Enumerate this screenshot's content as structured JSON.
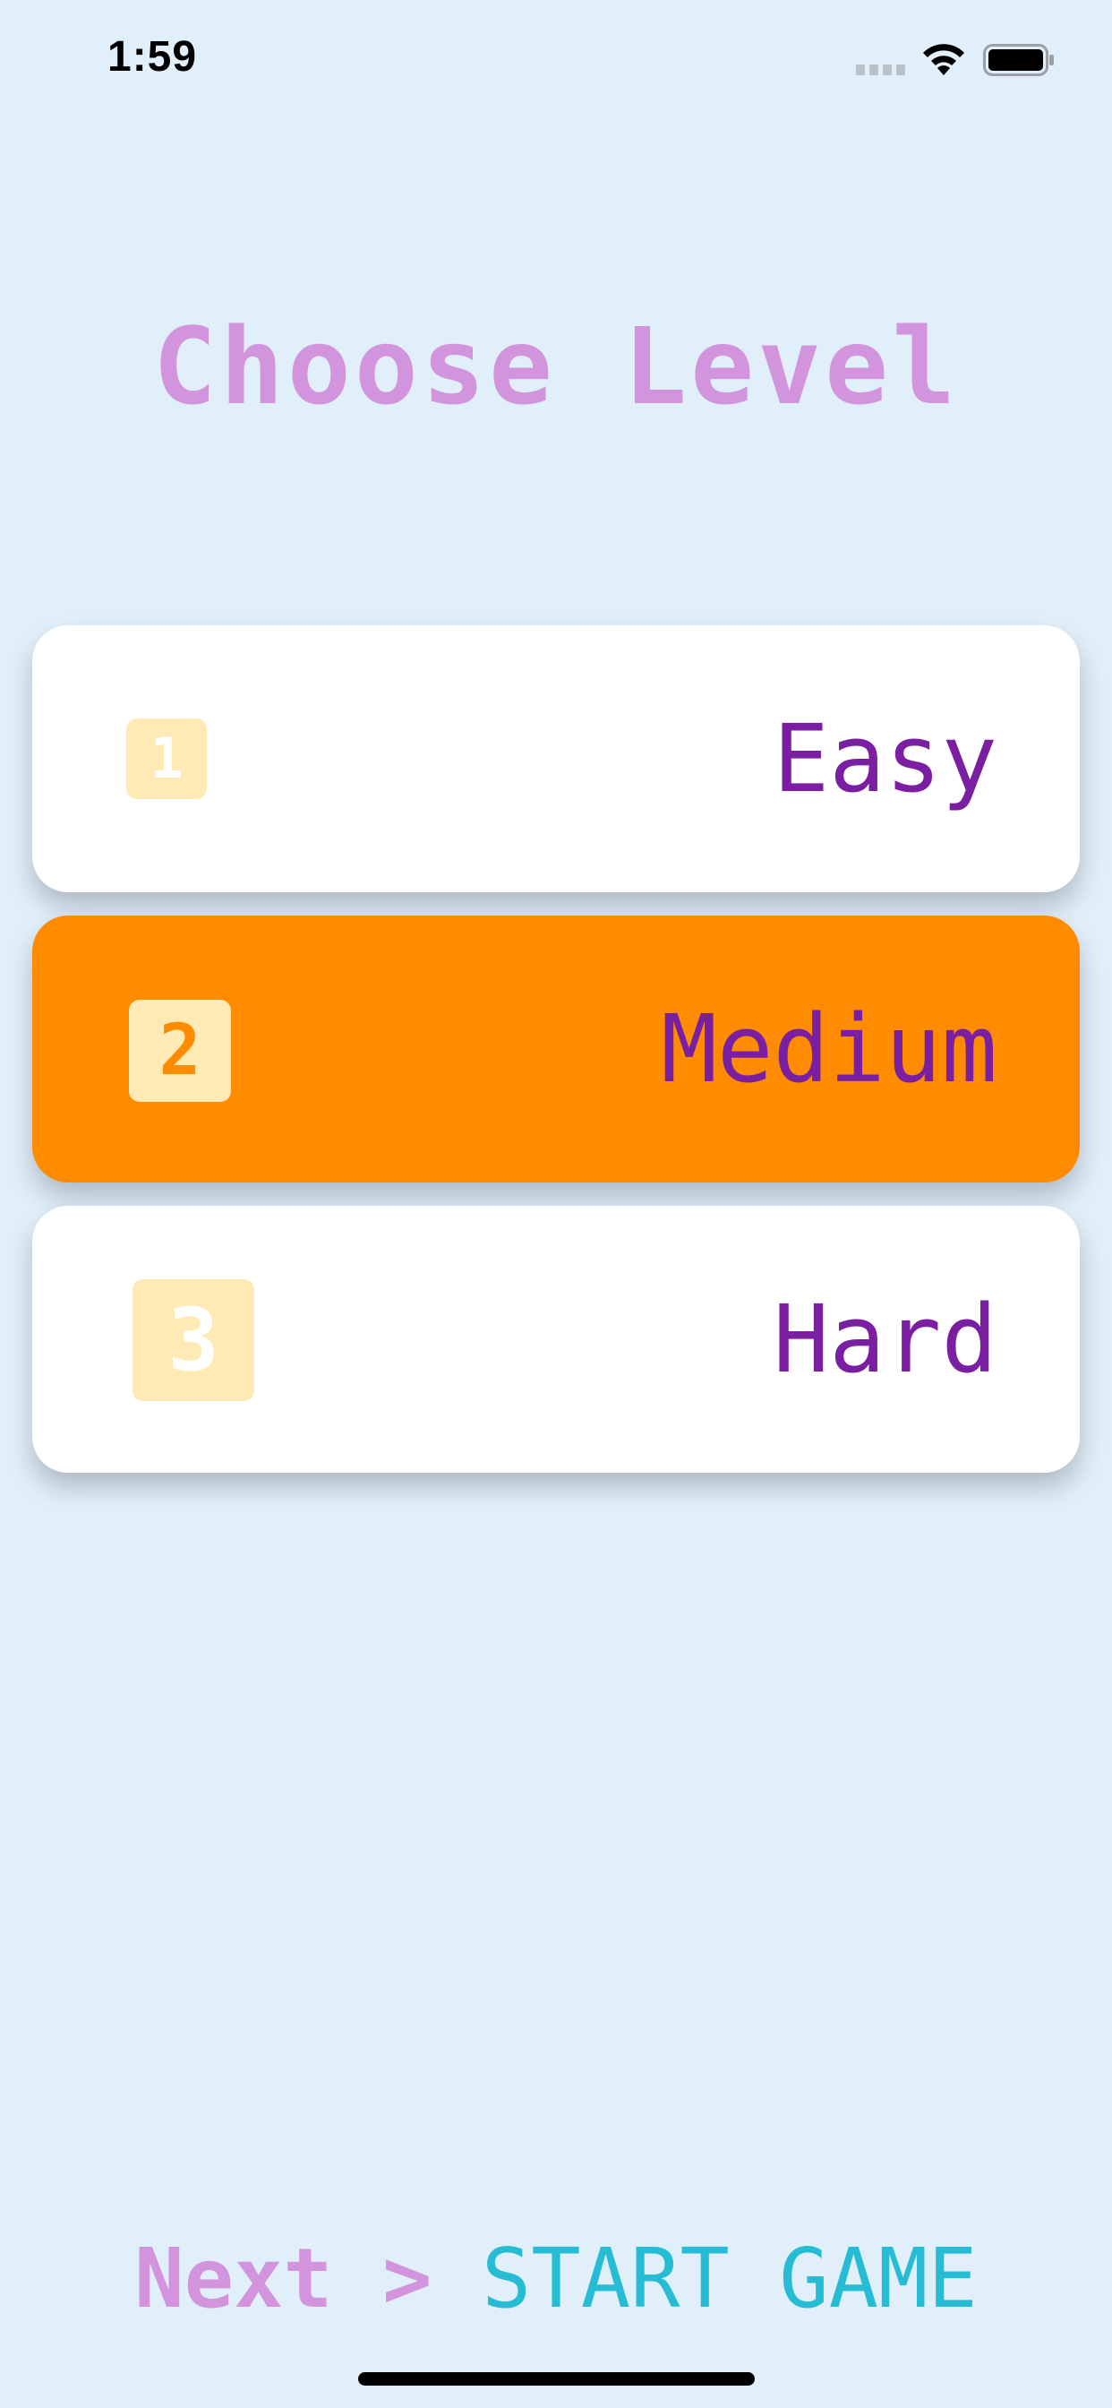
{
  "status_bar": {
    "time": "1:59",
    "icons": [
      "cellular-signal-icon",
      "wifi-icon",
      "battery-icon"
    ]
  },
  "screen": {
    "title": "Choose Level"
  },
  "levels": [
    {
      "number": "1",
      "label": "Easy",
      "selected": false
    },
    {
      "number": "2",
      "label": "Medium",
      "selected": true
    },
    {
      "number": "3",
      "label": "Hard",
      "selected": false
    }
  ],
  "footer": {
    "next_label": "Next >",
    "start_label": "START GAME"
  },
  "colors": {
    "background": "#e1effb",
    "title": "#d194dd",
    "selected_card": "#ff8c00",
    "level_label": "#7b1fa2",
    "badge": "#ffeab5",
    "start_game": "#26bcd4"
  }
}
